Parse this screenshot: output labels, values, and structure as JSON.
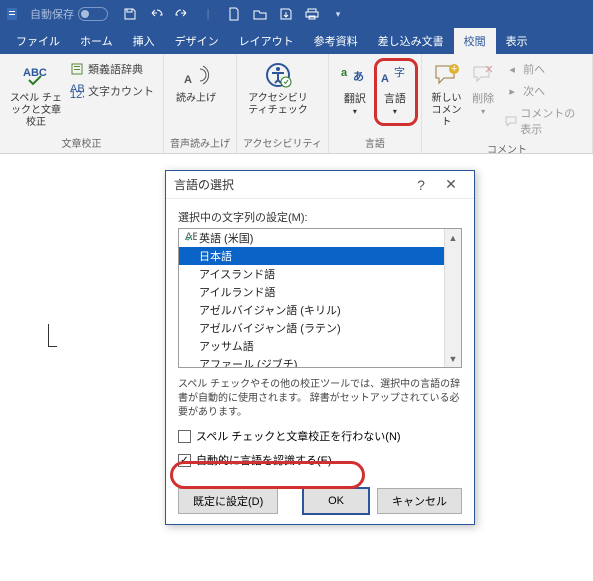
{
  "title": {
    "autosave_label": "自動保存"
  },
  "tabs": {
    "file": "ファイル",
    "home": "ホーム",
    "insert": "挿入",
    "design": "デザイン",
    "layout": "レイアウト",
    "references": "参考資料",
    "mailings": "差し込み文書",
    "review": "校閲",
    "view": "表示"
  },
  "ribbon": {
    "proofing": {
      "label": "文章校正",
      "spell": "スペル チェックと文章校正",
      "thesaurus": "類義語辞典",
      "wordcount": "文字カウント"
    },
    "speech": {
      "label": "音声読み上げ",
      "readaloud": "読み上げ"
    },
    "a11y": {
      "label": "アクセシビリティ",
      "check": "アクセシビリティチェック"
    },
    "language": {
      "label": "言語",
      "translate": "翻訳",
      "language": "言語"
    },
    "comments": {
      "label": "コメント",
      "new": "新しいコメント",
      "delete": "削除",
      "prev": "前へ",
      "next": "次へ",
      "show": "コメントの表示"
    }
  },
  "dialog": {
    "title": "言語の選択",
    "list_label": "選択中の文字列の設定(M):",
    "langs": [
      "英語 (米国)",
      "日本語",
      "アイスランド語",
      "アイルランド語",
      "アゼルバイジャン語 (キリル)",
      "アゼルバイジャン語 (ラテン)",
      "アッサム語",
      "アファール (ジブチ)"
    ],
    "selected_index": 1,
    "note": "スペル チェックやその他の校正ツールでは、選択中の言語の辞書が自動的に使用されます。 辞書がセットアップされている必要があります。",
    "chk_noproof": "スペル チェックと文章校正を行わない(N)",
    "chk_autodetect": "自動的に言語を認識する(E)",
    "btn_default": "既定に設定(D)",
    "btn_ok": "OK",
    "btn_cancel": "キャンセル"
  }
}
